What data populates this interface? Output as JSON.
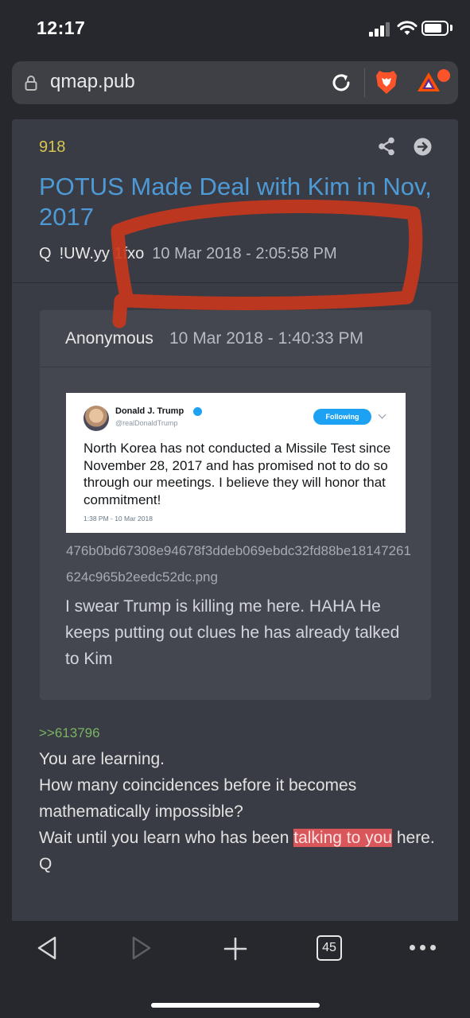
{
  "status_bar": {
    "time": "12:17"
  },
  "browser": {
    "url": "qmap.pub",
    "icons": [
      "lock-icon",
      "reload-icon",
      "brave-lion-icon",
      "brave-rewards-icon"
    ]
  },
  "post": {
    "number": "918",
    "title": "POTUS Made Deal with Kim in Nov, 2017",
    "author": "Q",
    "tripcode": "!UW.yy 1fxo",
    "date": "10 Mar 2018 - 2:05:58 PM",
    "icons": [
      "share-icon",
      "arrow-right-circle-icon"
    ]
  },
  "quote": {
    "author": "Anonymous",
    "date": "10 Mar 2018 - 1:40:33 PM",
    "tweet": {
      "name": "Donald J. Trump",
      "handle": "@realDonaldTrump",
      "follow_label": "Following",
      "text": "North Korea has not conducted a Missile Test since November 28, 2017 and has promised not to do so through our meetings. I believe they will honor that commitment!",
      "time": "1:38 PM - 10 Mar 2018"
    },
    "filename": "476b0bd67308e94678f3ddeb069ebdc32fd88be18147261624c965b2eedc52dc.png",
    "body": "I swear Trump is killing me here. HAHA He keeps putting out clues he has already talked to Kim"
  },
  "reply": {
    "link": ">>613796",
    "lines": [
      "You are learning.",
      "How many coincidences before it becomes mathematically impossible?"
    ],
    "line3_before": "Wait until you learn who has been ",
    "line3_highlight": "talking to you",
    "line3_after": " here.",
    "signature": "Q"
  },
  "toolbar": {
    "tab_count": "45"
  },
  "colors": {
    "background": "#26282d",
    "card": "#393c44",
    "title_link": "#4d9ad6",
    "post_number": "#d8c552",
    "reply_link": "#79b463",
    "highlight": "#d9575b",
    "marker": "#c8371c"
  }
}
